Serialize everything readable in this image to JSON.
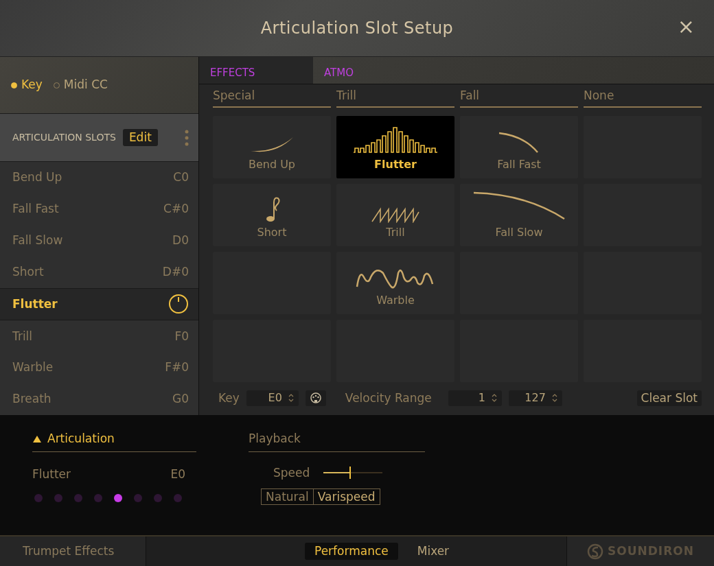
{
  "window": {
    "title": "Articulation Slot Setup",
    "close": "×"
  },
  "trigger_mode": [
    {
      "label": "Key",
      "selected": true
    },
    {
      "label": "Midi CC",
      "selected": false
    }
  ],
  "slots": {
    "header": "ARTICULATION SLOTS",
    "edit": "Edit",
    "items": [
      {
        "name": "Bend Up",
        "key": "C0",
        "selected": false
      },
      {
        "name": "Fall Fast",
        "key": "C#0",
        "selected": false
      },
      {
        "name": "Fall Slow",
        "key": "D0",
        "selected": false
      },
      {
        "name": "Short",
        "key": "D#0",
        "selected": false
      },
      {
        "name": "Flutter",
        "selected": true
      },
      {
        "name": "Trill",
        "key": "F0",
        "selected": false
      },
      {
        "name": "Warble",
        "key": "F#0",
        "selected": false
      },
      {
        "name": "Breath",
        "key": "G0",
        "selected": false
      }
    ]
  },
  "tabs": [
    {
      "label": "EFFECTS",
      "selected": true
    },
    {
      "label": "ATMO",
      "selected": false
    }
  ],
  "categories": [
    "Special",
    "Trill",
    "Fall",
    "None"
  ],
  "tiles": [
    {
      "kind": "bend",
      "label": "Bend Up",
      "selected": false
    },
    {
      "kind": "flutter",
      "label": "Flutter",
      "selected": true
    },
    {
      "kind": "fall_fast",
      "label": "Fall Fast",
      "selected": false
    },
    {
      "kind": "empty"
    },
    {
      "kind": "short",
      "label": "Short",
      "selected": false
    },
    {
      "kind": "trill",
      "label": "Trill",
      "selected": false
    },
    {
      "kind": "fall_slow",
      "label": "Fall Slow",
      "selected": false
    },
    {
      "kind": "empty"
    },
    {
      "kind": "empty"
    },
    {
      "kind": "warble",
      "label": "Warble",
      "selected": false
    },
    {
      "kind": "empty"
    },
    {
      "kind": "empty"
    },
    {
      "kind": "empty"
    },
    {
      "kind": "empty"
    },
    {
      "kind": "empty"
    },
    {
      "kind": "empty"
    }
  ],
  "slot_controls": {
    "key_label": "Key",
    "key_value": "E0",
    "velocity_label": "Velocity Range",
    "velocity_low": "1",
    "velocity_high": "127",
    "clear": "Clear Slot"
  },
  "articulation": {
    "title": "Articulation",
    "name": "Flutter",
    "key": "E0",
    "dots": [
      {
        "selected": false
      },
      {
        "selected": false
      },
      {
        "selected": false
      },
      {
        "selected": false
      },
      {
        "selected": true
      },
      {
        "selected": false
      },
      {
        "selected": false
      },
      {
        "selected": false
      }
    ]
  },
  "playback": {
    "title": "Playback",
    "speed_label": "Speed",
    "speed": {
      "level": 0.44
    },
    "modes": [
      {
        "label": "Natural",
        "selected": false
      },
      {
        "label": "Varispeed",
        "selected": true
      }
    ]
  },
  "footer": {
    "instrument": "Trumpet Effects",
    "views": [
      {
        "label": "Performance",
        "selected": true
      },
      {
        "label": "Mixer",
        "selected": false
      }
    ],
    "brand": "SOUNDIRON"
  }
}
